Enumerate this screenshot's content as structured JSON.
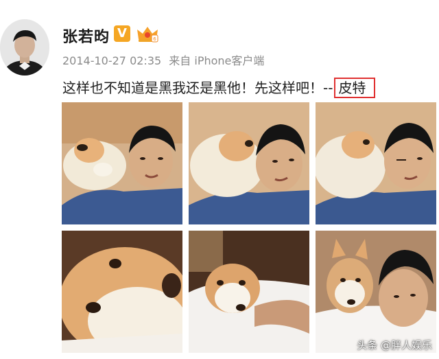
{
  "post": {
    "username": "张若昀",
    "verified_badge": "V",
    "timestamp": "2014-10-27 02:35",
    "source": "来自 iPhone客户端",
    "text": "这样也不知道是黑我还是黑他！先这样吧！--",
    "signature": "皮特"
  },
  "photos": [
    {
      "name": "photo-1",
      "subject": "man with husky puppy licking cheek"
    },
    {
      "name": "photo-2",
      "subject": "man with husky puppy kissing"
    },
    {
      "name": "photo-3",
      "subject": "man squinting with husky puppy"
    },
    {
      "name": "photo-4",
      "subject": "husky puppy close-up"
    },
    {
      "name": "photo-5",
      "subject": "husky puppy on white blanket"
    },
    {
      "name": "photo-6",
      "subject": "husky puppy with man under blanket"
    }
  ],
  "watermark": "头条 @胖人娱乐",
  "icons": {
    "verified": "verified-v-icon",
    "vip": "crown-vip-icon"
  },
  "colors": {
    "verified_badge": "#f5a623",
    "highlight_box": "#e03030",
    "meta_text": "#8a8a8a"
  }
}
